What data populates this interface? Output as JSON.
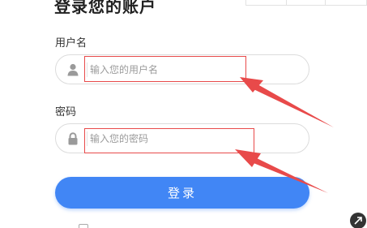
{
  "title": "登录您的账户",
  "username": {
    "label": "用户名",
    "placeholder": "输入您的用户名",
    "icon": "user-icon"
  },
  "password": {
    "label": "密码",
    "placeholder": "输入您的密码",
    "icon": "lock-icon"
  },
  "login_button": "登录",
  "colors": {
    "accent": "#4186f5",
    "annotation": "#e84a4a"
  }
}
